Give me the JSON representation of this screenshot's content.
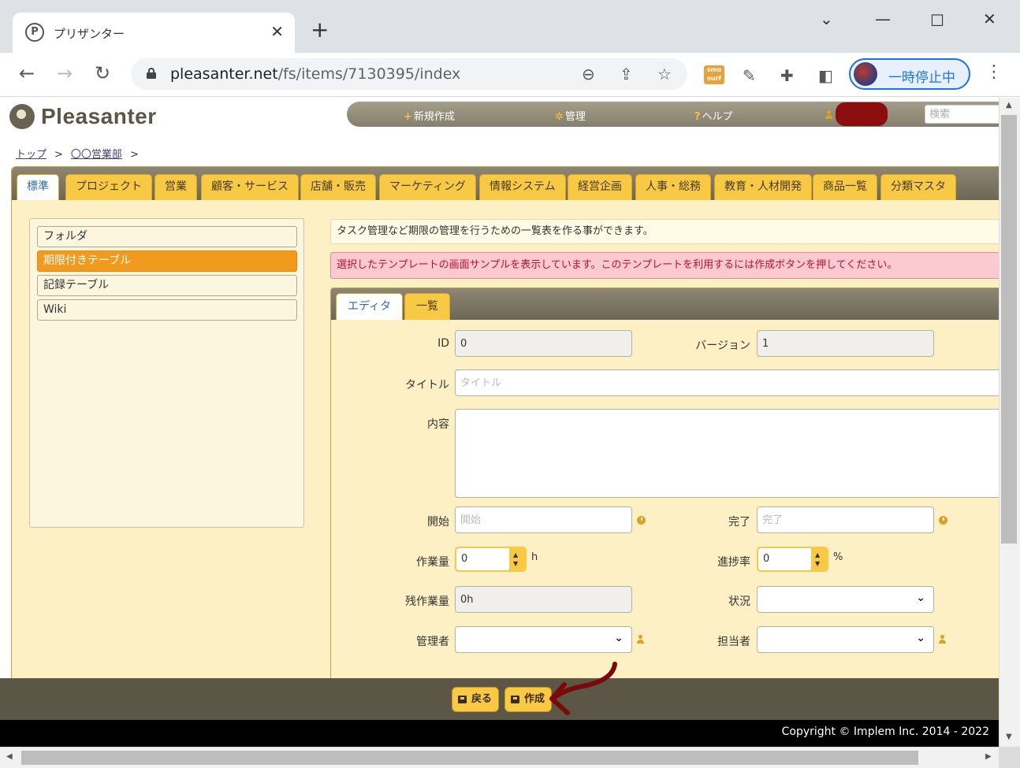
{
  "browser": {
    "tab_title": "プリザンター",
    "tab_favicon": "P",
    "url_host": "pleasanter.net",
    "url_path": "/fs/items/7130395/index",
    "profile_label": "一時停止中",
    "ext_smo": "smo surf"
  },
  "header": {
    "logo_text": "Pleasanter",
    "nav": {
      "new": "新規作成",
      "manage": "管理",
      "help": "ヘルプ"
    },
    "search_placeholder": "検索"
  },
  "breadcrumb": {
    "items": [
      "トップ",
      "〇〇営業部"
    ]
  },
  "category_tabs": [
    "標準",
    "プロジェクト",
    "営業",
    "顧客・サービス",
    "店舗・販売",
    "マーケティング",
    "情報システム",
    "経営企画",
    "人事・総務",
    "教育・人材開発",
    "商品一覧",
    "分類マスタ"
  ],
  "sidebar": {
    "items": [
      "フォルダ",
      "期限付きテーブル",
      "記録テーブル",
      "Wiki"
    ]
  },
  "info_message": "タスク管理など期限の管理を行うための一覧表を作る事ができます。",
  "alert_message": "選択したテンプレートの画面サンプルを表示しています。このテンプレートを利用するには作成ボタンを押してください。",
  "editor": {
    "tabs": [
      "エディタ",
      "一覧"
    ],
    "labels": {
      "id": "ID",
      "version": "バージョン",
      "title": "タイトル",
      "body": "内容",
      "start": "開始",
      "complete": "完了",
      "work_value": "作業量",
      "progress": "進捗率",
      "remaining": "残作業量",
      "status": "状況",
      "manager": "管理者",
      "owner": "担当者"
    },
    "values": {
      "id": "0",
      "version": "1",
      "work_value": "0",
      "progress": "0",
      "remaining": "0h"
    },
    "placeholders": {
      "title": "タイトル",
      "start": "開始",
      "complete": "完了"
    },
    "units": {
      "work_value": "h",
      "progress": "%"
    }
  },
  "actions": {
    "back": "戻る",
    "create": "作成"
  },
  "copyright": "Copyright © Implem Inc. 2014 - 2022",
  "colors": {
    "accent": "#f7c945",
    "active_side": "#f19a1e",
    "annotation": "#7a0a0a"
  }
}
